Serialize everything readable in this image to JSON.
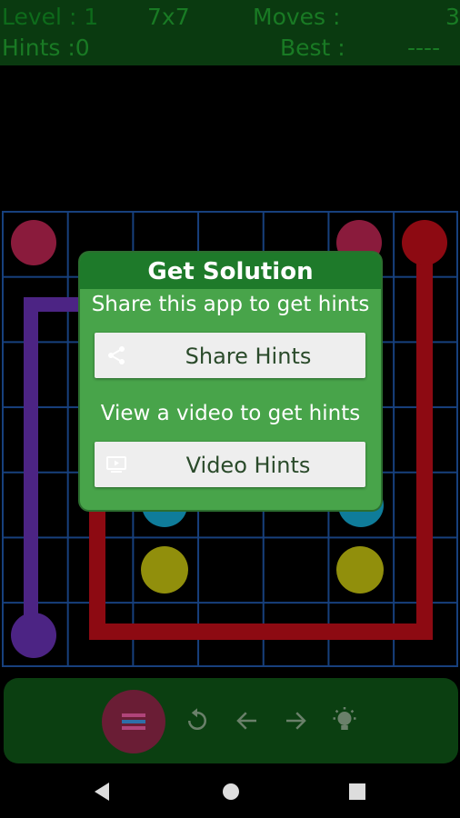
{
  "status": {
    "level_label": "Level : 1",
    "size_label": "7x7",
    "moves_label": "Moves :",
    "moves_value": "3",
    "hints_label": "Hints :0",
    "best_label": "Best :",
    "best_value": "----"
  },
  "dialog": {
    "title": "Get Solution",
    "share_text": "Share this app to get hints",
    "share_button": "Share Hints",
    "video_text": "View a video to get hints",
    "video_button": "Video Hints"
  },
  "colors": {
    "header_bg": "#0a3a10",
    "grid": "#17407d",
    "dot_pink": "#8a1b3c",
    "dot_red": "#8d0a12",
    "dot_purple": "#4c2484",
    "dot_yellow": "#918f0c",
    "dot_cyan": "#0f7c9a",
    "dialog_bg": "#48a44a",
    "dialog_title_bg": "#1e7a2a"
  },
  "toolbar": {
    "icons": [
      "menu-icon",
      "undo-icon",
      "arrow-left-icon",
      "arrow-right-icon",
      "hint-bulb-icon"
    ]
  },
  "navbar": {
    "icons": [
      "back-icon",
      "home-icon",
      "recents-icon"
    ]
  }
}
